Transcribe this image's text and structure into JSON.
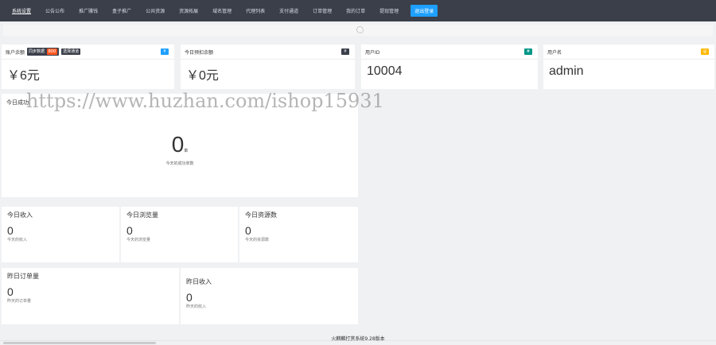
{
  "nav": {
    "items": [
      "系统设置",
      "公告公布",
      "推广赚钱",
      "盒子推广",
      "公共资源",
      "资源拓展",
      "域名管理",
      "代理列表",
      "支付通道",
      "订单管理",
      "我的订单",
      "提现管理"
    ],
    "logout_label": "退出登录"
  },
  "cards": {
    "balance": {
      "label": "账户余额",
      "tag1": "同步数据",
      "tag2": "800",
      "tag3": "选择通道",
      "value": "￥6元"
    },
    "deduct": {
      "label": "今日预扣余额",
      "value": "￥0元"
    },
    "uid": {
      "label": "用户ID",
      "value": "10004"
    },
    "username": {
      "label": "用户名",
      "value": "admin"
    }
  },
  "today_orders": {
    "title": "今日成功",
    "value": "0",
    "unit": "单",
    "sub": "今天的成功单数"
  },
  "stats": [
    {
      "title": "今日收入",
      "value": "0",
      "sub": "今天的收入"
    },
    {
      "title": "今日浏览量",
      "value": "0",
      "sub": "今天的浏览量"
    },
    {
      "title": "今日资源数",
      "value": "0",
      "sub": "今天的资源数"
    }
  ],
  "yesterday": [
    {
      "title": "昨日订单量",
      "value": "0",
      "sub": "昨天的订单量"
    },
    {
      "title": "昨日收入",
      "value": "0",
      "sub": "昨天的收入"
    }
  ],
  "watermark": "https://www.huzhan.com/ishop15931",
  "footer": "火麒麟打赏系统9.28版本",
  "colors": {
    "nav_bg": "#3a3f4a",
    "accent": "#1e9fff",
    "badge_green": "#009688",
    "badge_yellow": "#ffb800"
  }
}
